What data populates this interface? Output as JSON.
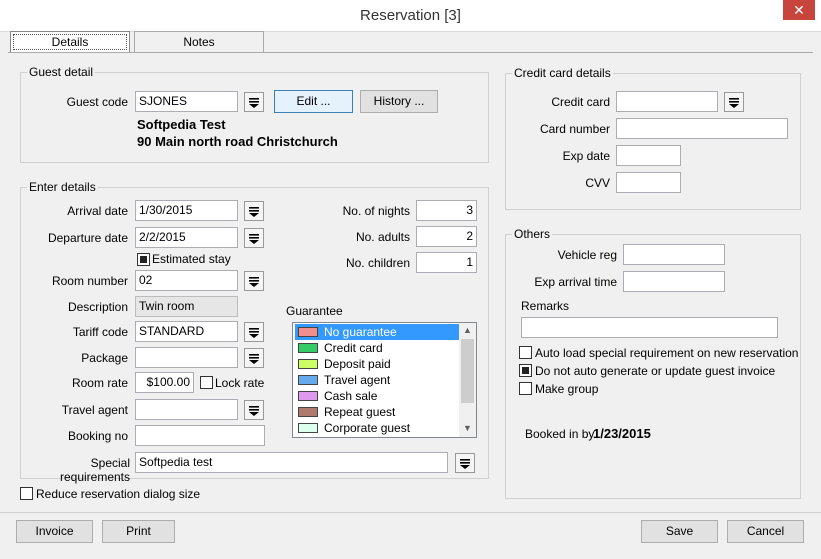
{
  "window": {
    "title": "Reservation [3]",
    "close": "✕"
  },
  "tabs": [
    {
      "label": "Details"
    },
    {
      "label": "Notes"
    }
  ],
  "guest": {
    "group_title": "Guest detail",
    "code_label": "Guest code",
    "code_value": "SJONES",
    "edit_btn": "Edit ...",
    "history_btn": "History ...",
    "name": "Softpedia Test",
    "address": "90 Main north road Christchurch"
  },
  "enter": {
    "group_title": "Enter details",
    "arrival_label": "Arrival date",
    "arrival_value": "1/30/2015",
    "departure_label": "Departure date",
    "departure_value": "2/2/2015",
    "estimated_label": "Estimated stay",
    "room_label": "Room number",
    "room_value": "02",
    "desc_label": "Description",
    "desc_value": "Twin room",
    "tariff_label": "Tariff code",
    "tariff_value": "STANDARD",
    "package_label": "Package",
    "package_value": "",
    "rate_label": "Room rate",
    "rate_value": "$100.00",
    "lock_label": "Lock rate",
    "agent_label": "Travel agent",
    "agent_value": "",
    "booking_label": "Booking no",
    "booking_value": "",
    "special_label": "Special requirements",
    "special_value": "Softpedia test",
    "nights_label": "No. of nights",
    "nights_value": "3",
    "adults_label": "No. adults",
    "adults_value": "2",
    "children_label": "No. children",
    "children_value": "1",
    "guarantee_label": "Guarantee",
    "guarantee_items": [
      {
        "label": "No guarantee",
        "color": "#f28e8e"
      },
      {
        "label": "Credit card",
        "color": "#33cc66"
      },
      {
        "label": "Deposit paid",
        "color": "#ccff66"
      },
      {
        "label": "Travel agent",
        "color": "#66aaee"
      },
      {
        "label": "Cash sale",
        "color": "#dd99ee"
      },
      {
        "label": "Repeat guest",
        "color": "#b07b6f"
      },
      {
        "label": "Corporate guest",
        "color": "#ddfff0"
      }
    ]
  },
  "reduce_label": "Reduce reservation dialog size",
  "credit": {
    "group_title": "Credit card details",
    "card_label": "Credit card",
    "card_value": "",
    "number_label": "Card number",
    "number_value": "",
    "exp_label": "Exp date",
    "exp_value": "",
    "cvv_label": "CVV",
    "cvv_value": ""
  },
  "others": {
    "group_title": "Others",
    "vehicle_label": "Vehicle reg",
    "vehicle_value": "",
    "arrival_time_label": "Exp arrival time",
    "arrival_time_value": "",
    "remarks_label": "Remarks",
    "remarks_value": "",
    "auto_load_label": "Auto load special requirement on new reservation",
    "no_invoice_label": "Do not auto generate or update guest invoice",
    "make_group_label": "Make group",
    "booked_label": "Booked in by",
    "booked_value": "1/23/2015"
  },
  "footer": {
    "invoice": "Invoice",
    "print": "Print",
    "save": "Save",
    "cancel": "Cancel"
  }
}
